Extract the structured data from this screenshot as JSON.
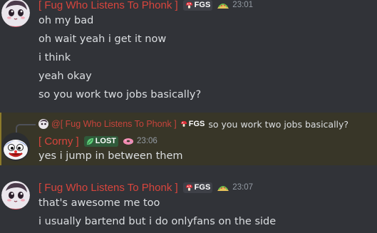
{
  "messages": [
    {
      "username": "[ Fug Who Listens To Phonk ]",
      "tag": "FGS",
      "tag_icon": "mushroom-icon",
      "decoration_icon": "taco-icon",
      "timestamp": "23:01",
      "lines": [
        "oh my bad",
        "oh wait yeah i get it now",
        "i think",
        "yeah okay",
        "so you work two jobs basically?"
      ]
    },
    {
      "reply": {
        "mention": "@[ Fug Who Listens To Phonk ]",
        "tag": "FGS",
        "text": "so you work two jobs basically?"
      },
      "username": "[ Corny ]",
      "tag": "LOST",
      "tag_icon": "leaf-icon",
      "decoration_icon": "donut-icon",
      "timestamp": "23:06",
      "lines": [
        "yes i jump in between them"
      ],
      "highlighted": true
    },
    {
      "username": "[ Fug Who Listens To Phonk ]",
      "tag": "FGS",
      "tag_icon": "mushroom-icon",
      "decoration_icon": "taco-icon",
      "timestamp": "23:07",
      "lines": [
        "that's awesome me too",
        "i usually bartend but i do onlyfans on the side"
      ]
    }
  ],
  "colors": {
    "background": "#313338",
    "username": "#d8453d",
    "text": "#dbdee1",
    "timestamp": "#949ba4",
    "highlight": "#383628"
  }
}
